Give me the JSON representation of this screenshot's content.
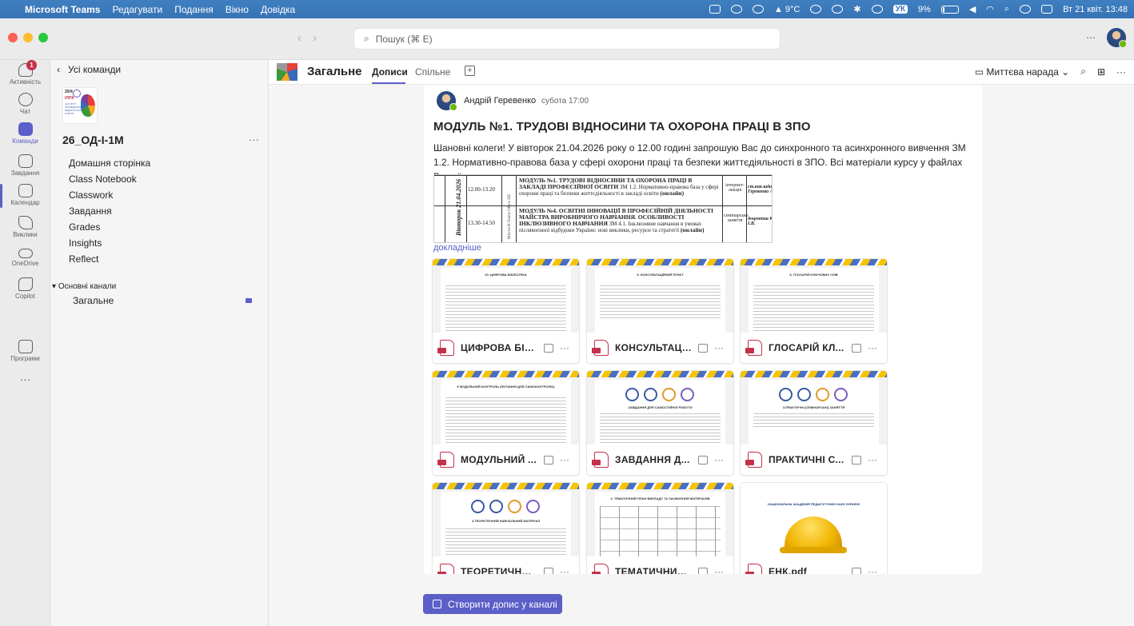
{
  "menubar": {
    "app": "Microsoft Teams",
    "menus": [
      "Редагувати",
      "Подання",
      "Вікно",
      "Довідка"
    ],
    "weather": "9°C",
    "lang": "УК",
    "battery": "9%",
    "datetime": "Вт 21 квіт. 13:48"
  },
  "titlebar": {
    "search_placeholder": "Пошук (⌘ E)",
    "more": "⋯"
  },
  "rail": {
    "items": [
      "Активність",
      "Чат",
      "Команди",
      "Завдання",
      "Календар",
      "Виклики",
      "OneDrive",
      "Copilot",
      "Програми"
    ],
    "activity_badge": "1"
  },
  "panel": {
    "back_label": "Усі команди",
    "team_logo": {
      "l1": "20/4",
      "l2": "ІЛПК",
      "l3": "ІНСТИТУТ ПІСЛЯДИПЛОМНОЇ ПЕДАГОГІЧНОЇ ОСВІТИ"
    },
    "team_name": "26_ОД-І-1М",
    "nav": [
      "Домашня сторінка",
      "Class Notebook",
      "Classwork",
      "Завдання",
      "Grades",
      "Insights",
      "Reflect"
    ],
    "channels_header": "Основні канали",
    "channel": "Загальне"
  },
  "header": {
    "channel_name": "Загальне",
    "tabs": [
      "Дописи",
      "Спільне"
    ],
    "meet_label": "Миттєва нарада"
  },
  "post": {
    "author": "Андрій Геревенко",
    "time": "субота 17:00",
    "subject": "МОДУЛЬ №1. ТРУДОВІ ВІДНОСИНИ ТА ОХОРОНА ПРАЦІ В ЗПО",
    "body": "Шановні колеги! У вівторок 21.04.2026 року о 12.00 годині запрошую Вас до синхронного та асинхронного вивчення ЗМ 1.2. Нормативно-правова база у сфері охорони праці та безпеки життєдіяльності в ЗПО. Всі матеріали курсу у файлах Вашої групи.",
    "more_link": "докладніше",
    "schedule": {
      "date": "Вівторок 21.04.2026",
      "platform": "Microsoft Teams Office 365",
      "row1_time": "12.00-13.20",
      "row1_title": "МОДУЛЬ №1. ТРУДОВІ ВІДНОСИНИ ТА ОХОРОНА ПРАЦІ В ЗАКЛАДІ ПРОФЕСІЙНОЇ ОСВІТИ",
      "row1_text": "ЗМ 1.2. Нормативно-правова база у сфері охорони праці та безпеки життєдіяльності в закладі освіти",
      "row1_online": "(онлайн)",
      "row1_type": "інтернет-лекція",
      "row1_teacher": "ст.викладач Геревенко А.М.",
      "row2_time": "13.30-14.50",
      "row2_title": "МОДУЛЬ №4. ОСВІТНІ ІННОВАЦІЇ В ПРОФЕСІЙНІЙ ДІЯЛЬНОСТІ МАЙСТРА ВИРОБНИЧОГО НАВЧАННЯ. ОСОБЛИВОСТІ ІНКЛЮЗИВНОГО НАВЧАННЯ",
      "row2_text": "ЗМ 4.1. Інклюзивне навчання в умовах післявоєнної відбудови України: нові виклики, ресурси та стратегії",
      "row2_online": "(онлайн)",
      "row2_type": "семінарське заняття",
      "row2_teacher": "доцентка Кучерак І.В."
    },
    "files": [
      {
        "name": "ЦИФРОВА БІБ...",
        "thumb_title": "20. ЦИФРОВА БІБЛІОТЕКА"
      },
      {
        "name": "КОНСУЛЬТАЦІ...",
        "thumb_title": "9. КОНСУЛЬТАЦІЙНИЙ ПУНКТ"
      },
      {
        "name": "ГЛОСАРІЙ КЛ...",
        "thumb_title": "8. ГЛОСАРІЙ КЛЮЧОВИХ СЛІВ"
      },
      {
        "name": "МОДУЛЬНИЙ ...",
        "thumb_title": "5 МОДУЛЬНИЙ КОНТРОЛЬ (ПИТАННЯ ДЛЯ САМОКОНТРОЛЮ)"
      },
      {
        "name": "ЗАВДАННЯ Д...",
        "thumb_title": "ЗАВДАННЯ ДЛЯ САМОСТІЙНОЇ РОБОТИ"
      },
      {
        "name": "ПРАКТИЧНІ С...",
        "thumb_title": "3.ПРАКТИЧНІ (СЕМІНАРСЬКІ) ЗАНЯТТЯ"
      },
      {
        "name": "ТЕОРЕТИЧНИ...",
        "thumb_title": "4.ТЕОРЕТИЧНИЙ НАВЧАЛЬНИЙ МАТЕРІАЛ"
      },
      {
        "name": "ТЕМАТИЧНИЙ ...",
        "thumb_title": "2. ТЕМАТИЧНИЙ ПЛАН ВИКЛАДУ ТА ЗАСВОЄННЯ МАТЕРІАЛІВ"
      },
      {
        "name": "ЕНК.pdf",
        "thumb_title": "НАЦІОНАЛЬНА АКАДЕМІЯ ПЕДАГОГІЧНИХ НАУК УКРАЇНИ"
      }
    ]
  },
  "compose_label": "Створити допис у каналі",
  "colors": {
    "accent": "#5b5fc7",
    "menubar": "#3a77b9",
    "badge": "#c4314b",
    "pdf": "#c4314b"
  }
}
